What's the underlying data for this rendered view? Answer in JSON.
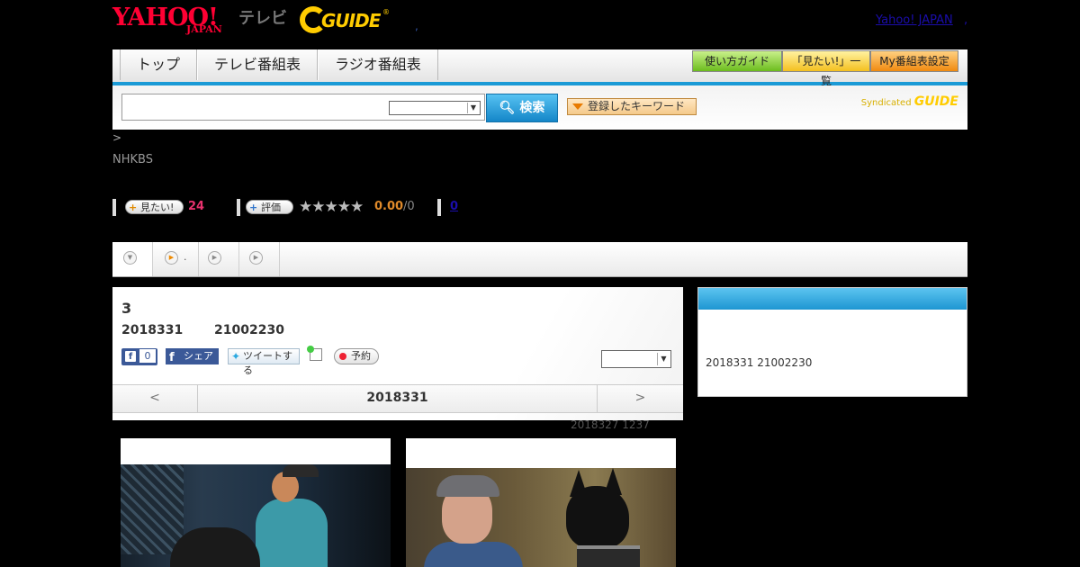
{
  "header": {
    "yahoo_logo": "YAHOO!",
    "yahoo_japan": "JAPAN",
    "tv_label": "テレビ",
    "gguide_logo": "GUIDE",
    "gguide_reg": "®",
    "header_dot": ",",
    "yahoo_japan_link": "Yahoo! JAPAN",
    "link_separator": ","
  },
  "nav": {
    "tabs": [
      {
        "label": "トップ"
      },
      {
        "label": "テレビ番組表"
      },
      {
        "label": "ラジオ番組表"
      }
    ],
    "buttons": [
      {
        "label": "使い方ガイド",
        "color": "#8ed83c"
      },
      {
        "label": "「見たい!」一覧",
        "color": "#f7d04a"
      },
      {
        "label": "My番組表設定",
        "color": "#f5a83a"
      }
    ],
    "accent_color": "#1a9ad6"
  },
  "search": {
    "input_value": "",
    "select_value": "",
    "search_button": "検索",
    "keyword_button": "登録したキーワード",
    "syndicated": "Syndicated",
    "syndicated_logo": "GUIDE"
  },
  "breadcrumb": ">",
  "channel": "NHKBS",
  "stats": {
    "mitai_label": "見たい!",
    "mitai_count": "24",
    "rating_label": "評価",
    "stars": "★★★★★",
    "rating_value": 0.0,
    "score": "0.00",
    "score_den": "/0",
    "comment_count": "0"
  },
  "subtabs": [
    {
      "icon": "down-circle-icon",
      "label": ""
    },
    {
      "icon": "play-circle-icon",
      "label": "."
    },
    {
      "icon": "play-circle-icon",
      "label": ""
    },
    {
      "icon": "play-circle-icon",
      "label": ""
    }
  ],
  "program": {
    "title": "3",
    "date": "2018331",
    "time": "21002230",
    "fb_like_count": "0",
    "fb_share_label": "シェア",
    "tweet_label": "ツイートする",
    "reserve_label": "予約",
    "select_value": ""
  },
  "day_nav": {
    "prev": "<",
    "current": "2018331",
    "next": ">"
  },
  "updated": "2018327  1237",
  "side_panel": {
    "title": "",
    "text": "2018331  21002230"
  },
  "colors": {
    "background": "#000000",
    "mitai": "#e8326e",
    "score": "#e08a2a",
    "link": "#1a0dab"
  }
}
